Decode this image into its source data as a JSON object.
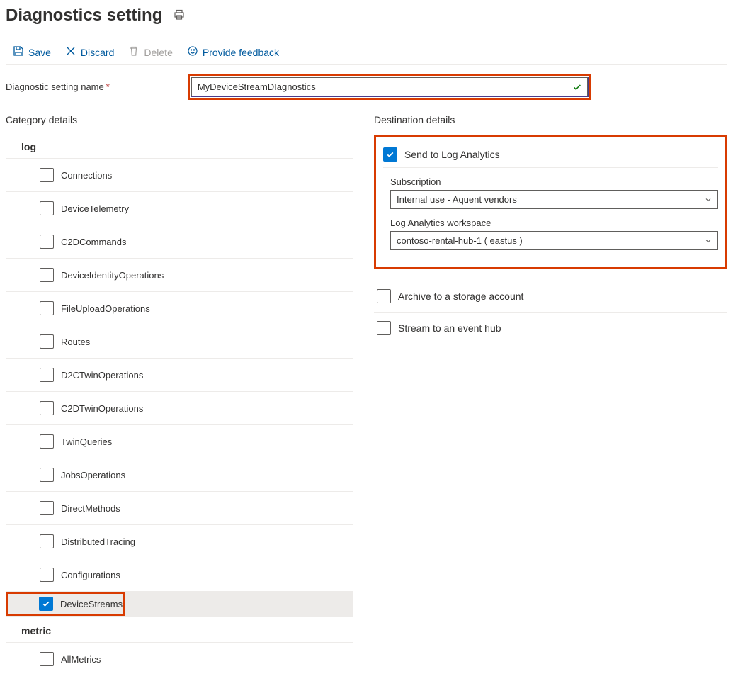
{
  "page": {
    "title": "Diagnostics setting"
  },
  "toolbar": {
    "save": "Save",
    "discard": "Discard",
    "delete": "Delete",
    "feedback": "Provide feedback"
  },
  "form": {
    "name_label": "Diagnostic setting name",
    "name_value": "MyDeviceStreamDIagnostics"
  },
  "categories": {
    "header": "Category details",
    "groups": {
      "log": "log",
      "metric": "metric"
    },
    "logs": [
      {
        "label": "Connections",
        "checked": false
      },
      {
        "label": "DeviceTelemetry",
        "checked": false
      },
      {
        "label": "C2DCommands",
        "checked": false
      },
      {
        "label": "DeviceIdentityOperations",
        "checked": false
      },
      {
        "label": "FileUploadOperations",
        "checked": false
      },
      {
        "label": "Routes",
        "checked": false
      },
      {
        "label": "D2CTwinOperations",
        "checked": false
      },
      {
        "label": "C2DTwinOperations",
        "checked": false
      },
      {
        "label": "TwinQueries",
        "checked": false
      },
      {
        "label": "JobsOperations",
        "checked": false
      },
      {
        "label": "DirectMethods",
        "checked": false
      },
      {
        "label": "DistributedTracing",
        "checked": false
      },
      {
        "label": "Configurations",
        "checked": false
      },
      {
        "label": "DeviceStreams",
        "checked": true
      }
    ],
    "metrics": [
      {
        "label": "AllMetrics",
        "checked": false
      }
    ]
  },
  "destination": {
    "header": "Destination details",
    "log_analytics": {
      "label": "Send to Log Analytics",
      "checked": true,
      "subscription_label": "Subscription",
      "subscription_value": "Internal use - Aquent vendors",
      "workspace_label": "Log Analytics workspace",
      "workspace_value": "contoso-rental-hub-1 ( eastus )"
    },
    "storage": {
      "label": "Archive to a storage account",
      "checked": false
    },
    "eventhub": {
      "label": "Stream to an event hub",
      "checked": false
    }
  }
}
